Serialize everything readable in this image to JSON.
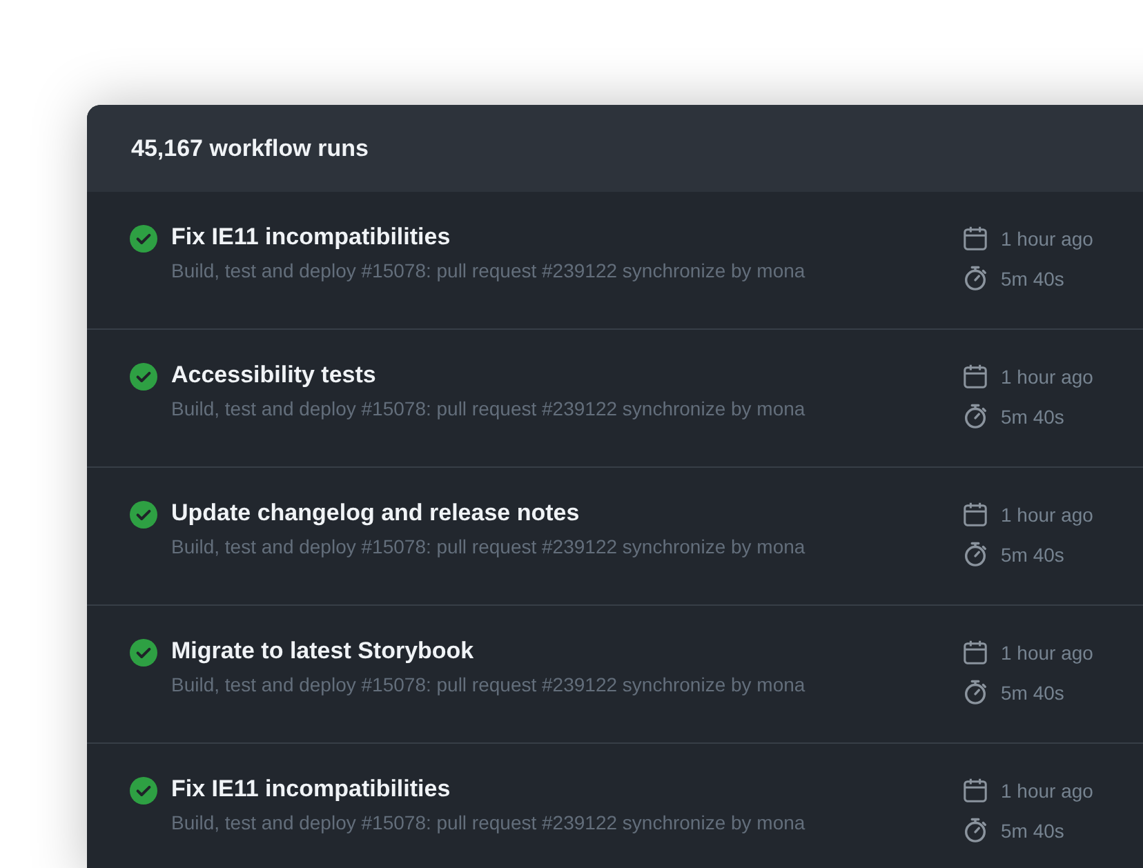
{
  "header": {
    "title": "45,167 workflow runs"
  },
  "runs": [
    {
      "kind": "success",
      "title": "Fix IE11 incompatibilities",
      "description": "Build, test and deploy #15078: pull request #239122 synchronize by mona",
      "time": "1 hour ago",
      "duration": "5m 40s"
    },
    {
      "kind": "success",
      "title": "Accessibility tests",
      "description": "Build, test and deploy #15078: pull request #239122 synchronize by mona",
      "time": "1 hour ago",
      "duration": "5m 40s"
    },
    {
      "kind": "success",
      "title": "Update changelog and release notes",
      "description": "Build, test and deploy #15078: pull request #239122 synchronize by mona",
      "time": "1 hour ago",
      "duration": "5m 40s"
    },
    {
      "kind": "success",
      "title": "Migrate to latest Storybook",
      "description": "Build, test and deploy #15078: pull request #239122 synchronize by mona",
      "time": "1 hour ago",
      "duration": "5m 40s"
    },
    {
      "kind": "success",
      "title": "Fix IE11 incompatibilities",
      "description": "Build, test and deploy #15078: pull request #239122 synchronize by mona",
      "time": "1 hour ago",
      "duration": "5m 40s"
    }
  ]
}
